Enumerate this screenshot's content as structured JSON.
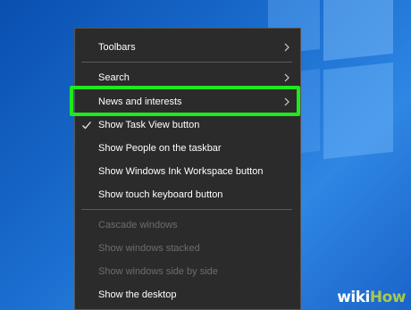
{
  "menu": {
    "items": [
      {
        "label": "Toolbars",
        "submenu": true
      },
      {
        "label": "Search",
        "submenu": true
      },
      {
        "label": "News and interests",
        "submenu": true
      },
      {
        "label": "Show Task View button",
        "checked": true
      },
      {
        "label": "Show People on the taskbar"
      },
      {
        "label": "Show Windows Ink Workspace button"
      },
      {
        "label": "Show touch keyboard button"
      },
      {
        "label": "Cascade windows",
        "disabled": true
      },
      {
        "label": "Show windows stacked",
        "disabled": true
      },
      {
        "label": "Show windows side by side",
        "disabled": true
      },
      {
        "label": "Show the desktop"
      }
    ]
  },
  "watermark": {
    "part1": "wiki",
    "part2": "How",
    "brand_color": "#a8c94c"
  },
  "colors": {
    "highlight": "#1eea1e",
    "menu_bg": "#2b2b2b",
    "desktop": "#1b6fd0"
  }
}
